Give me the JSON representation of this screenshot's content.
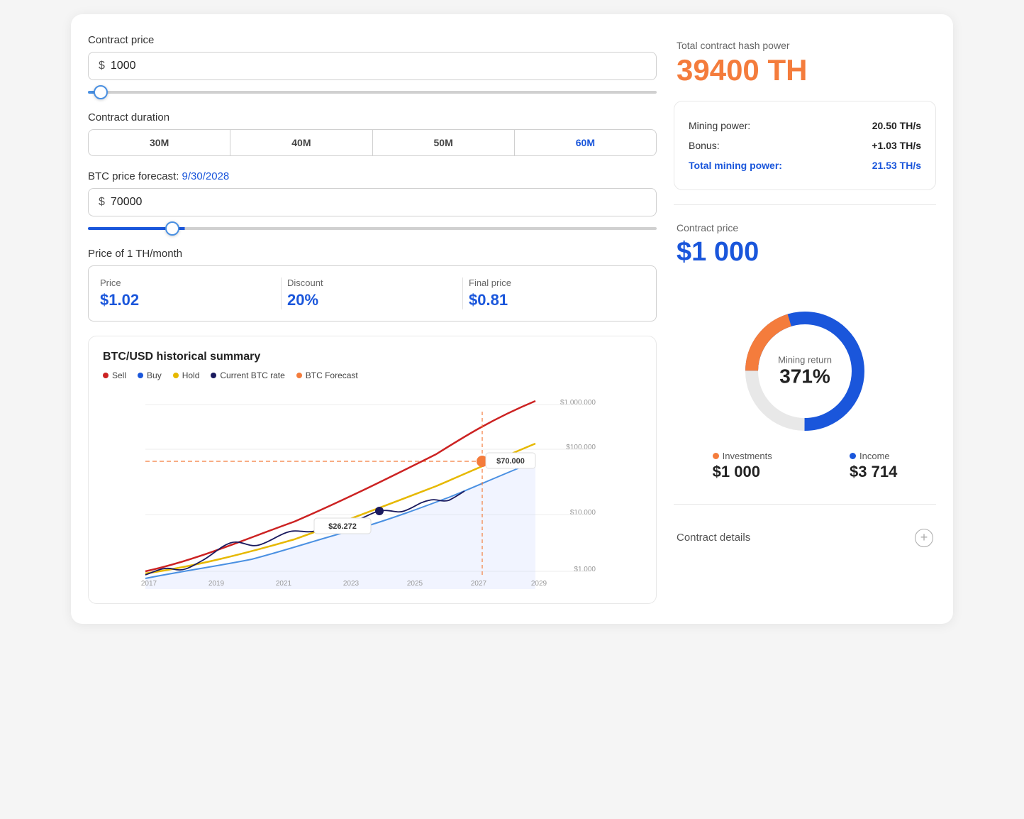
{
  "left": {
    "contract_price_label": "Contract price",
    "contract_price_value": "1000",
    "contract_price_symbol": "$",
    "contract_duration_label": "Contract duration",
    "duration_tabs": [
      {
        "label": "30M",
        "active": false
      },
      {
        "label": "40M",
        "active": false
      },
      {
        "label": "50M",
        "active": false
      },
      {
        "label": "60M",
        "active": true
      }
    ],
    "btc_forecast_label": "BTC price forecast:",
    "btc_forecast_date": "9/30/2028",
    "btc_price_symbol": "$",
    "btc_price_value": "70000",
    "price_of_th_label": "Price of 1 TH/month",
    "price_col1_label": "Price",
    "price_col1_value": "$1.02",
    "price_col2_label": "Discount",
    "price_col2_value": "20%",
    "price_col3_label": "Final price",
    "price_col3_value": "$0.81",
    "chart": {
      "title": "BTC/USD historical summary",
      "legend": [
        {
          "label": "Sell",
          "color": "#cc2222"
        },
        {
          "label": "Buy",
          "color": "#1a56db"
        },
        {
          "label": "Hold",
          "color": "#e6b800"
        },
        {
          "label": "Current BTC rate",
          "color": "#1a1a5e"
        },
        {
          "label": "BTC Forecast",
          "color": "#f47c3c"
        }
      ],
      "y_labels": [
        "$1.000.000",
        "$100.000",
        "$10.000",
        "$1.000"
      ],
      "x_labels": [
        "2017",
        "2019",
        "2021",
        "2023",
        "2025",
        "2027",
        "2029"
      ],
      "current_price_label": "$26.272",
      "forecast_price_label": "$70.000"
    }
  },
  "right": {
    "hash_power_section": {
      "label": "Total contract hash power",
      "value": "39400 TH"
    },
    "mining_power_section": {
      "mining_power_label": "Mining power:",
      "mining_power_value": "20.50 TH/s",
      "bonus_label": "Bonus:",
      "bonus_value": "+1.03 TH/s",
      "total_label": "Total mining power:",
      "total_value": "21.53 TH/s"
    },
    "contract_price_section": {
      "label": "Contract price",
      "value": "$1 000"
    },
    "donut": {
      "center_label": "Mining return",
      "center_value": "371%",
      "investments_label": "Investments",
      "investments_value": "$1 000",
      "income_label": "Income",
      "income_value": "$3 714",
      "investments_color": "#f47c3c",
      "income_color": "#1a56db"
    },
    "contract_details_label": "Contract details"
  }
}
